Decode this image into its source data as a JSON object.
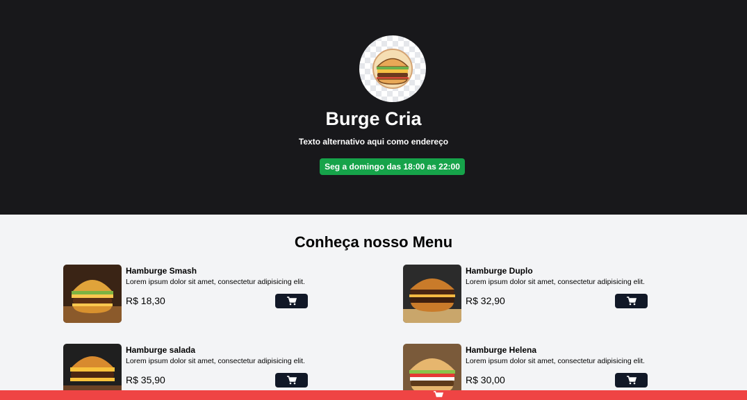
{
  "header": {
    "logo_icon": "burger-logo-icon",
    "title": "Burge Cria",
    "subtitle": "Texto alternativo aqui como endereço",
    "hours": "Seg a domingo das 18:00 as 22:00",
    "hours_color": "#16a34a"
  },
  "menu": {
    "title": "Conheça nosso Menu",
    "items": [
      {
        "name": "Hamburge Smash",
        "description": "Lorem ipsum dolor sit amet, consectetur adipisicing elit.",
        "price": "R$ 18,30",
        "icon": "cart-icon"
      },
      {
        "name": "Hamburge Duplo",
        "description": "Lorem ipsum dolor sit amet, consectetur adipisicing elit.",
        "price": "R$ 32,90",
        "icon": "cart-icon"
      },
      {
        "name": "Hamburge salada",
        "description": "Lorem ipsum dolor sit amet, consectetur adipisicing elit.",
        "price": "R$ 35,90",
        "icon": "cart-icon"
      },
      {
        "name": "Hamburge Helena",
        "description": "Lorem ipsum dolor sit amet, consectetur adipisicing elit.",
        "price": "R$ 30,00",
        "icon": "cart-icon"
      }
    ]
  },
  "footer": {
    "color": "#ef4444",
    "icon": "cart-icon"
  }
}
